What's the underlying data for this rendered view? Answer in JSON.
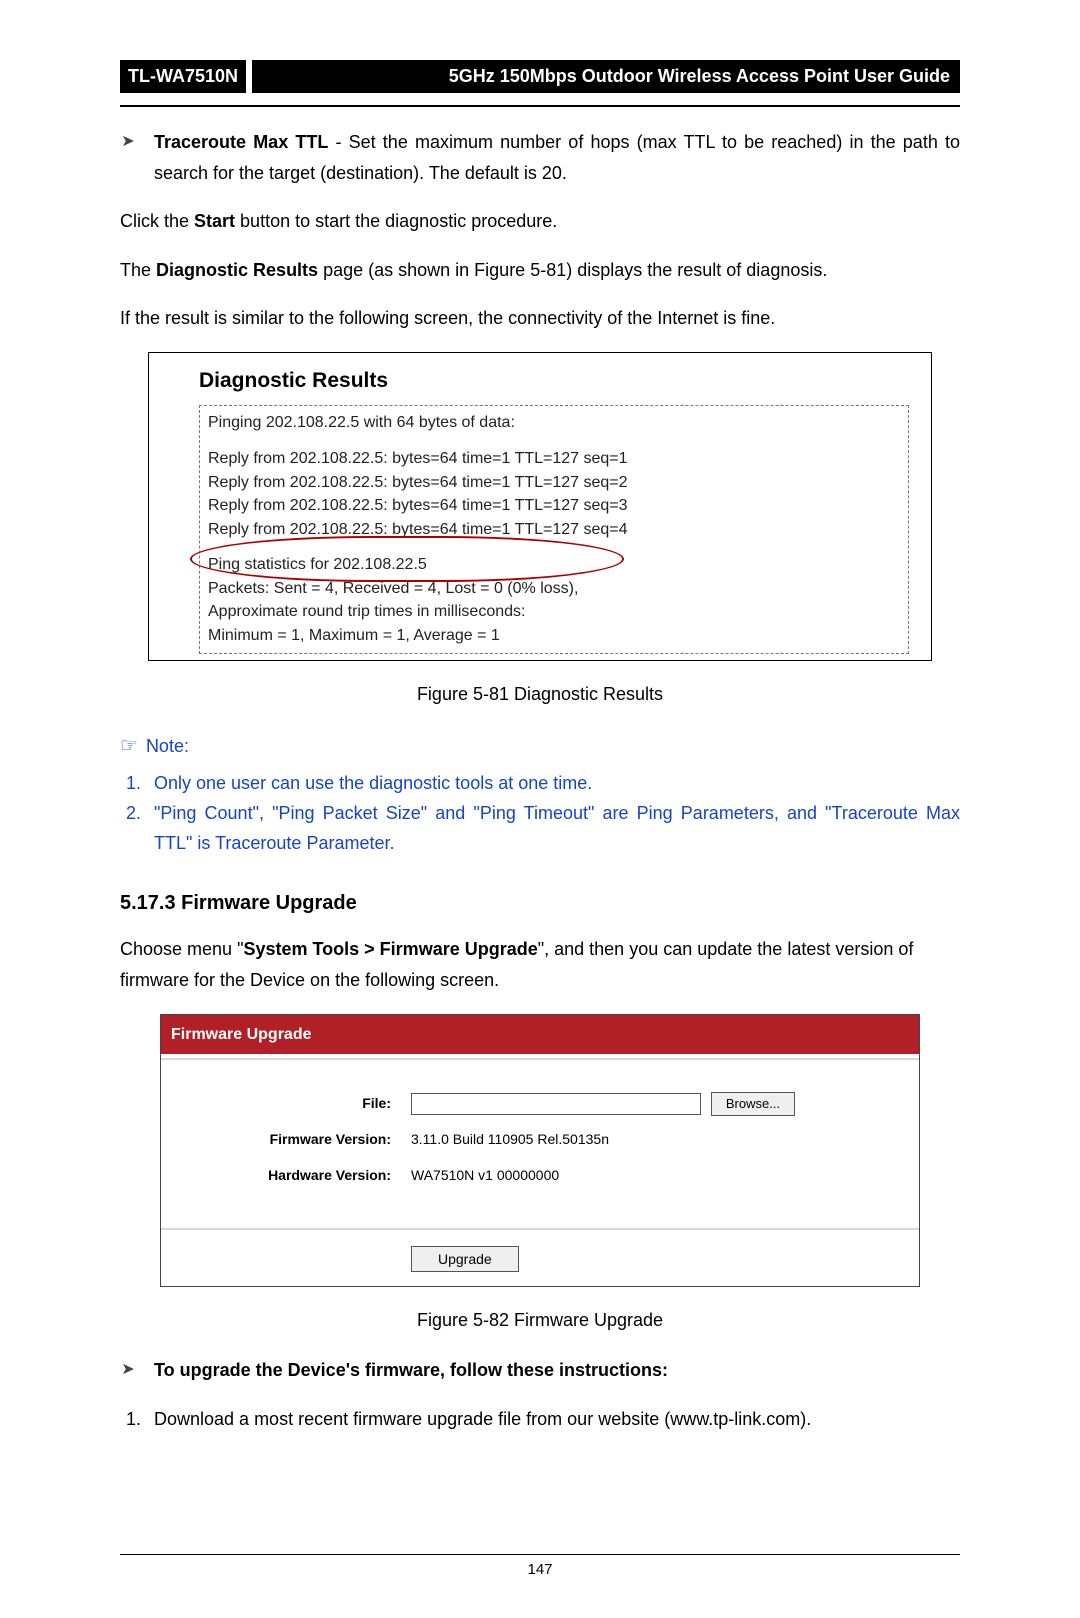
{
  "header": {
    "model": "TL-WA7510N",
    "title": "5GHz 150Mbps Outdoor Wireless Access Point User Guide"
  },
  "traceroute": {
    "label": "Traceroute Max TTL",
    "desc": " - Set the maximum number of hops (max TTL to be reached) in the path to search for the target (destination). The default is 20."
  },
  "para_start": {
    "pre": "Click the ",
    "bold": "Start",
    "post": " button to start the diagnostic procedure."
  },
  "para_results": {
    "pre": "The ",
    "bold": "Diagnostic Results",
    "post": " page (as shown in Figure 5-81) displays the result of diagnosis."
  },
  "para_fine": "If the result is similar to the following screen, the connectivity of the Internet is fine.",
  "diag_box": {
    "title": "Diagnostic Results",
    "ping_header": "Pinging 202.108.22.5 with 64 bytes of data:",
    "r1": "Reply from 202.108.22.5:  bytes=64  time=1  TTL=127  seq=1",
    "r2": "Reply from 202.108.22.5:  bytes=64  time=1  TTL=127  seq=2",
    "r3": "Reply from 202.108.22.5:  bytes=64  time=1  TTL=127  seq=3",
    "r4": "Reply from 202.108.22.5:  bytes=64  time=1  TTL=127  seq=4",
    "s1": "Ping statistics for 202.108.22.5",
    "s2": "  Packets: Sent = 4, Received = 4, Lost = 0 (0% loss),",
    "s3": "Approximate round trip times in milliseconds:",
    "s4": "  Minimum = 1, Maximum = 1, Average = 1"
  },
  "fig81": "Figure 5-81 Diagnostic Results",
  "note": {
    "head": "Note:",
    "n1": "Only one user can use the diagnostic tools at one time.",
    "n2": "\"Ping Count\", \"Ping Packet Size\" and \"Ping Timeout\" are Ping Parameters, and \"Traceroute Max TTL\" is Traceroute Parameter."
  },
  "fw_section": "5.17.3 Firmware Upgrade",
  "fw_intro": {
    "pre": "Choose menu \"",
    "bold": "System Tools > Firmware Upgrade",
    "post": "\", and then you can update the latest version of firmware for the Device on the following screen."
  },
  "fw_box": {
    "title": "Firmware Upgrade",
    "file_label": "File:",
    "file_value": "",
    "browse": "Browse...",
    "fv_label": "Firmware Version:",
    "fv_value": "3.11.0 Build 110905 Rel.50135n",
    "hv_label": "Hardware Version:",
    "hv_value": "WA7510N v1 00000000",
    "upgrade": "Upgrade"
  },
  "fig82": "Figure 5-82 Firmware Upgrade",
  "inst_head": "To upgrade the Device's firmware, follow these instructions:",
  "inst1": "Download a most recent firmware upgrade file from our website (www.tp-link.com).",
  "page_number": "147"
}
